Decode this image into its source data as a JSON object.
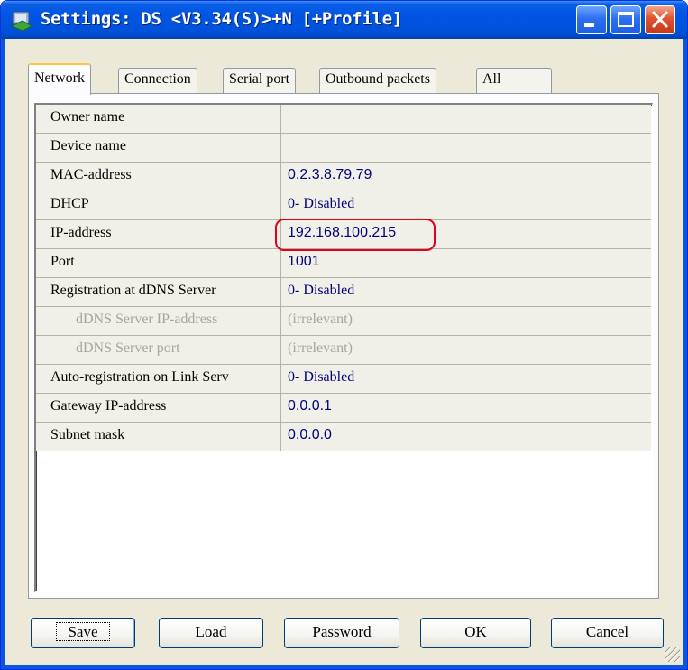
{
  "window": {
    "title": "Settings: DS <V3.34(S)>+N [+Profile]"
  },
  "tabs": [
    {
      "label": "Network",
      "active": true
    },
    {
      "label": "Connection",
      "active": false
    },
    {
      "label": "Serial port",
      "active": false
    },
    {
      "label": "Outbound packets",
      "active": false
    },
    {
      "label": "All",
      "active": false
    }
  ],
  "settings": [
    {
      "name": "Owner name",
      "value": ""
    },
    {
      "name": "Device name",
      "value": ""
    },
    {
      "name": "MAC-address",
      "value": "0.2.3.8.79.79"
    },
    {
      "name": "DHCP",
      "value": "0- Disabled"
    },
    {
      "name": "IP-address",
      "value": "192.168.100.215"
    },
    {
      "name": "Port",
      "value": "1001"
    },
    {
      "name": "Registration at dDNS Server",
      "value": "0- Disabled"
    },
    {
      "name": "dDNS Server IP-address",
      "value": "(irrelevant)"
    },
    {
      "name": "dDNS Server port",
      "value": "(irrelevant)"
    },
    {
      "name": "Auto-registration on Link Serv",
      "value": "0- Disabled"
    },
    {
      "name": "Gateway IP-address",
      "value": "0.0.0.1"
    },
    {
      "name": "Subnet mask",
      "value": "0.0.0.0"
    }
  ],
  "buttons": {
    "save": "Save",
    "load": "Load",
    "password": "Password",
    "ok": "OK",
    "cancel": "Cancel"
  },
  "colors": {
    "title_bar": "#0054e3",
    "value_text": "#00007f",
    "highlight_ring": "#e0001a",
    "active_tab_accent": "#ffc83c"
  }
}
